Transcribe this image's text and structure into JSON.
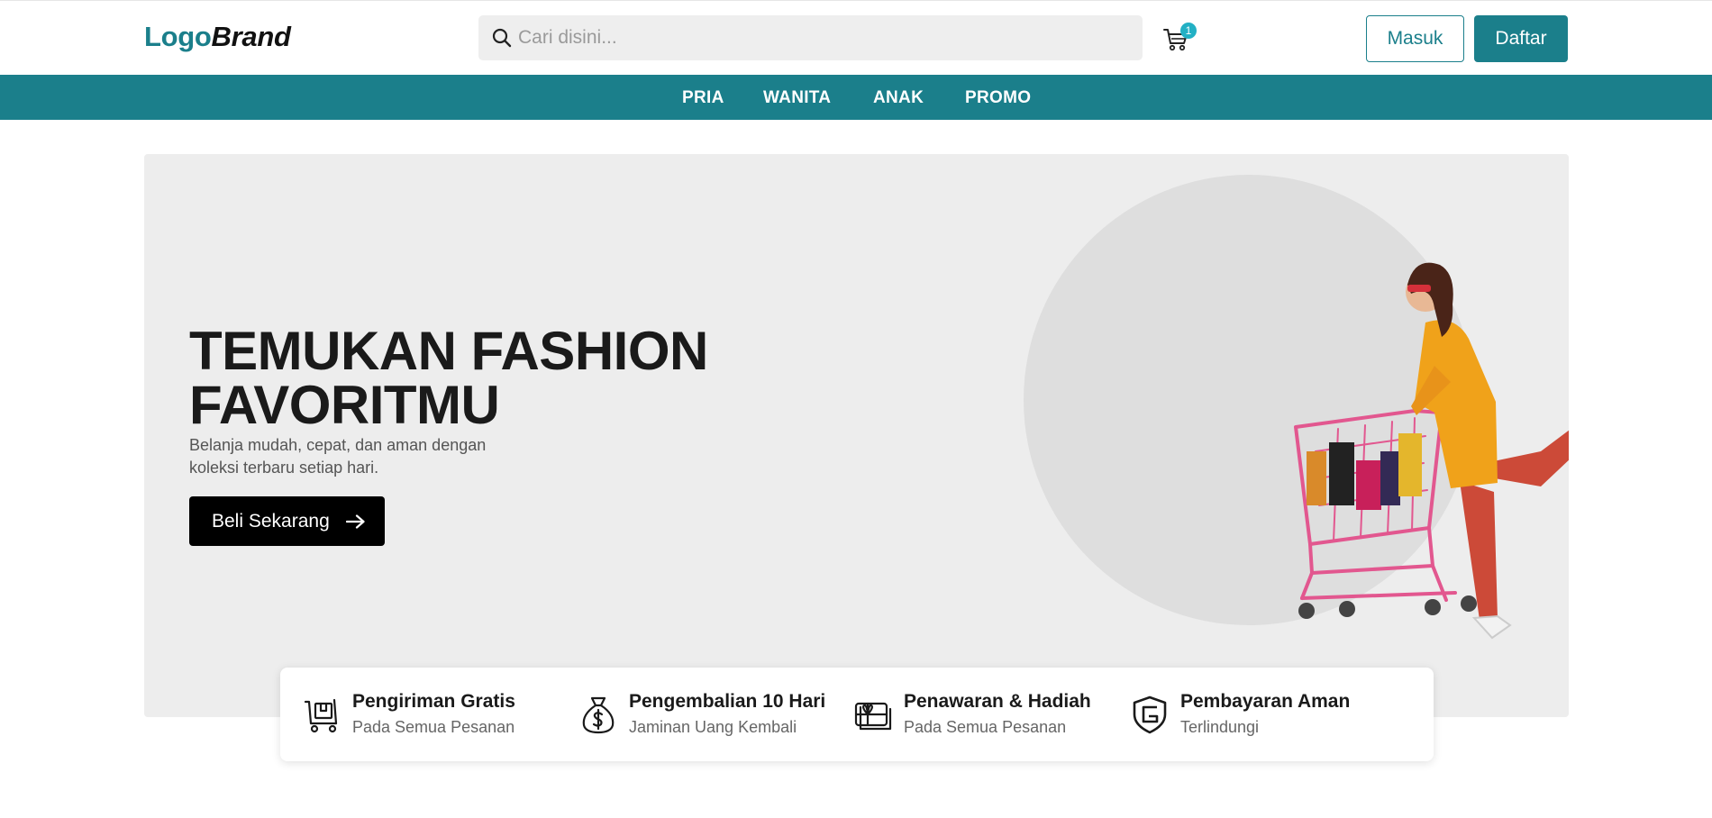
{
  "header": {
    "logo_part1": "Logo",
    "logo_part2": "Brand",
    "search_placeholder": "Cari disini...",
    "cart_count": "1",
    "login_label": "Masuk",
    "register_label": "Daftar"
  },
  "nav": {
    "items": [
      {
        "label": "PRIA"
      },
      {
        "label": "WANITA"
      },
      {
        "label": "ANAK"
      },
      {
        "label": "PROMO"
      }
    ]
  },
  "hero": {
    "title_line1": "TEMUKAN FASHION",
    "title_line2": "FAVORITMU",
    "subtitle_line1": "Belanja mudah, cepat, dan aman dengan",
    "subtitle_line2": "koleksi terbaru setiap hari.",
    "cta_label": "Beli Sekarang"
  },
  "features": [
    {
      "title": "Pengiriman Gratis",
      "subtitle": "Pada Semua Pesanan",
      "icon": "delivery-cart-icon"
    },
    {
      "title": "Pengembalian 10 Hari",
      "subtitle": "Jaminan Uang Kembali",
      "icon": "money-bag-icon"
    },
    {
      "title": "Penawaran & Hadiah",
      "subtitle": "Pada Semua Pesanan",
      "icon": "gift-card-icon"
    },
    {
      "title": "Pembayaran Aman",
      "subtitle": "Terlindungi",
      "icon": "secure-shield-icon"
    }
  ],
  "colors": {
    "brand": "#1b7f8b",
    "badge": "#22b0c4",
    "hero_bg": "#ededed",
    "dark": "#000000"
  }
}
